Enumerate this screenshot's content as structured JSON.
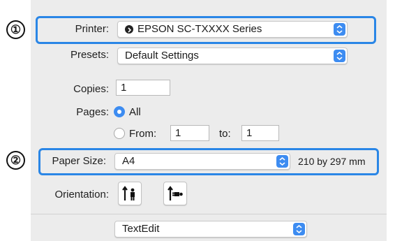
{
  "callouts": {
    "one": "①",
    "two": "②"
  },
  "printer": {
    "label": "Printer:",
    "value": "EPSON SC-TXXXX Series",
    "status_icon": "printer-status-icon"
  },
  "presets": {
    "label": "Presets:",
    "value": "Default Settings"
  },
  "copies": {
    "label": "Copies:",
    "value": "1"
  },
  "pages": {
    "label": "Pages:",
    "all_label": "All",
    "from_label": "From:",
    "from_value": "1",
    "to_label": "to:",
    "to_value": "1",
    "selected": "All"
  },
  "paper_size": {
    "label": "Paper Size:",
    "value": "A4",
    "dimensions": "210 by 297 mm"
  },
  "orientation": {
    "label": "Orientation:",
    "options": [
      "portrait-icon",
      "landscape-icon"
    ],
    "selected": "portrait"
  },
  "section_menu": {
    "value": "TextEdit"
  },
  "colors": {
    "accent": "#3d8cf1",
    "highlight": "#2a86e6",
    "panel": "#ececec"
  }
}
